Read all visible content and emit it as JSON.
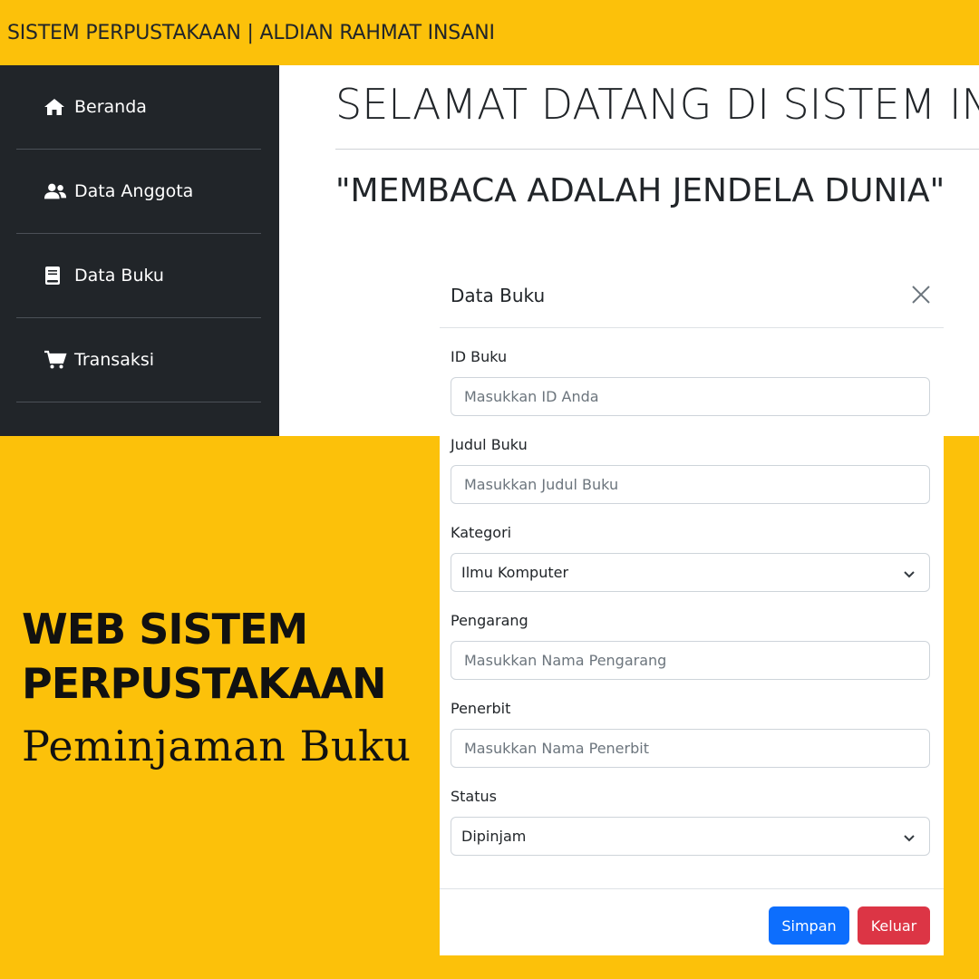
{
  "app": {
    "title": "SISTEM PERPUSTAKAAN | ALDIAN RAHMAT INSANI"
  },
  "sidebar": {
    "items": [
      {
        "label": "Beranda",
        "icon": "home-icon"
      },
      {
        "label": "Data Anggota",
        "icon": "users-icon"
      },
      {
        "label": "Data Buku",
        "icon": "book-icon"
      },
      {
        "label": "Transaksi",
        "icon": "cart-icon"
      }
    ]
  },
  "main": {
    "welcome": "SELAMAT DATANG DI SISTEM IN",
    "quote": "\"MEMBACA ADALAH JENDELA DUNIA\""
  },
  "promo": {
    "line1": "WEB SISTEM",
    "line2": "PERPUSTAKAAN",
    "subtitle": "Peminjaman Buku"
  },
  "modal": {
    "title": "Data Buku",
    "fields": {
      "id": {
        "label": "ID Buku",
        "placeholder": "Masukkan ID Anda"
      },
      "judul": {
        "label": "Judul Buku",
        "placeholder": "Masukkan Judul Buku"
      },
      "kategori": {
        "label": "Kategori",
        "value": "Ilmu Komputer"
      },
      "pengarang": {
        "label": "Pengarang",
        "placeholder": "Masukkan Nama Pengarang"
      },
      "penerbit": {
        "label": "Penerbit",
        "placeholder": "Masukkan Nama Penerbit"
      },
      "status": {
        "label": "Status",
        "value": "Dipinjam"
      }
    },
    "buttons": {
      "save": "Simpan",
      "exit": "Keluar"
    }
  },
  "colors": {
    "accent": "#fcc10a",
    "sidebar_bg": "#212529",
    "primary": "#0d6efd",
    "danger": "#dc3545"
  }
}
